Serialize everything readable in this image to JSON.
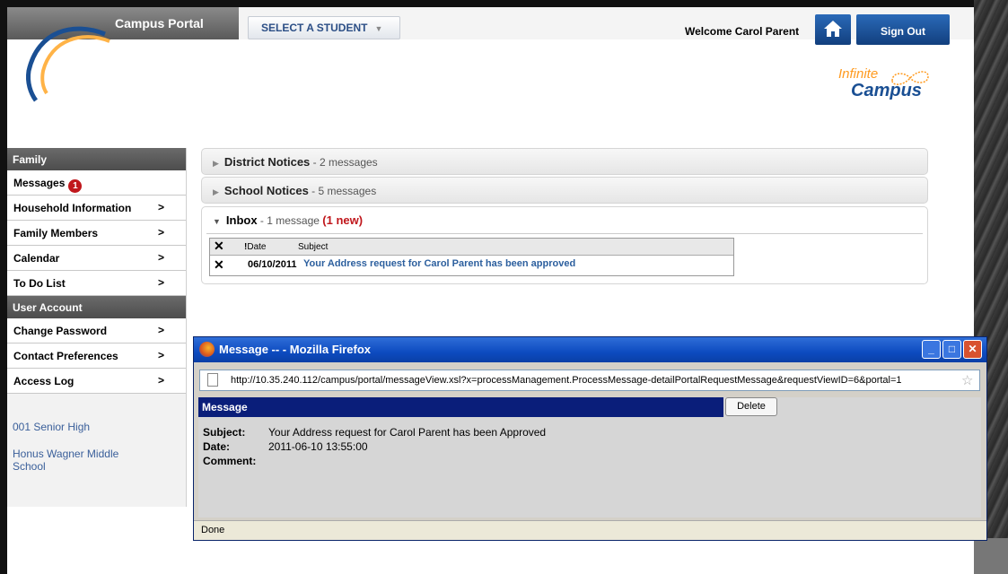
{
  "header": {
    "portal_title": "Campus Portal",
    "student_select": "SELECT A STUDENT",
    "welcome": "Welcome Carol Parent",
    "sign_out": "Sign Out",
    "logo_line1": "Infinite",
    "logo_line2": "Campus"
  },
  "sidebar": {
    "section_family": "Family",
    "messages": {
      "label": "Messages",
      "badge": "1"
    },
    "items": [
      {
        "label": "Household Information"
      },
      {
        "label": "Family Members"
      },
      {
        "label": "Calendar"
      },
      {
        "label": "To Do List"
      }
    ],
    "section_account": "User Account",
    "account_items": [
      {
        "label": "Change Password"
      },
      {
        "label": "Contact Preferences"
      },
      {
        "label": "Access Log"
      }
    ],
    "schools": [
      "001 Senior High",
      "Honus Wagner Middle",
      "School"
    ]
  },
  "notices": {
    "district": {
      "name": "District Notices",
      "count": " - 2 messages"
    },
    "school": {
      "name": "School Notices",
      "count": " - 5 messages"
    },
    "inbox": {
      "name": "Inbox",
      "count": " - 1 message ",
      "new": "(1 new)"
    }
  },
  "inbox_table": {
    "headers": {
      "flag": "!",
      "date": "Date",
      "subject": "Subject"
    },
    "rows": [
      {
        "date": "06/10/2011",
        "subject": "Your Address request for Carol Parent has been approved"
      }
    ]
  },
  "popup": {
    "title": "Message -- - Mozilla Firefox",
    "url": "http://10.35.240.112/campus/portal/messageView.xsl?x=processManagement.ProcessMessage-detailPortalRequestMessage&requestViewID=6&portal=1",
    "message_header": "Message",
    "delete": "Delete",
    "subject_label": "Subject:",
    "subject_value": "Your Address request for Carol Parent has been Approved",
    "date_label": "Date:",
    "date_value": "2011-06-10 13:55:00",
    "comment_label": "Comment:",
    "status": "Done"
  },
  "colors": {
    "brand_blue": "#1a4f93",
    "badge_red": "#c0171c",
    "logo_orange": "#ff9a1e",
    "message_bar": "#0a1e7a"
  }
}
